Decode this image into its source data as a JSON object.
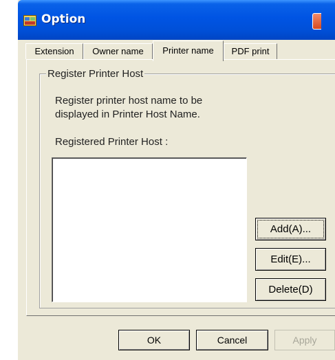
{
  "window": {
    "title": "Option"
  },
  "tabs": [
    {
      "label": "Extension",
      "active": false
    },
    {
      "label": "Owner name",
      "active": false
    },
    {
      "label": "Printer name",
      "active": true
    },
    {
      "label": "PDF print",
      "active": false
    }
  ],
  "group": {
    "title": "Register Printer Host",
    "description_line1": "Register printer host name to be",
    "description_line2": "displayed in Printer Host Name.",
    "list_label": "Registered Printer Host :",
    "items": []
  },
  "buttons": {
    "add": "Add(A)...",
    "edit": "Edit(E)...",
    "delete": "Delete(D)"
  },
  "footer": {
    "ok": "OK",
    "cancel": "Cancel",
    "apply": "Apply",
    "apply_disabled": true
  },
  "colors": {
    "titlebar": "#0054e3",
    "dialog_bg": "#ece9d8",
    "disabled_text": "#a7a699"
  }
}
